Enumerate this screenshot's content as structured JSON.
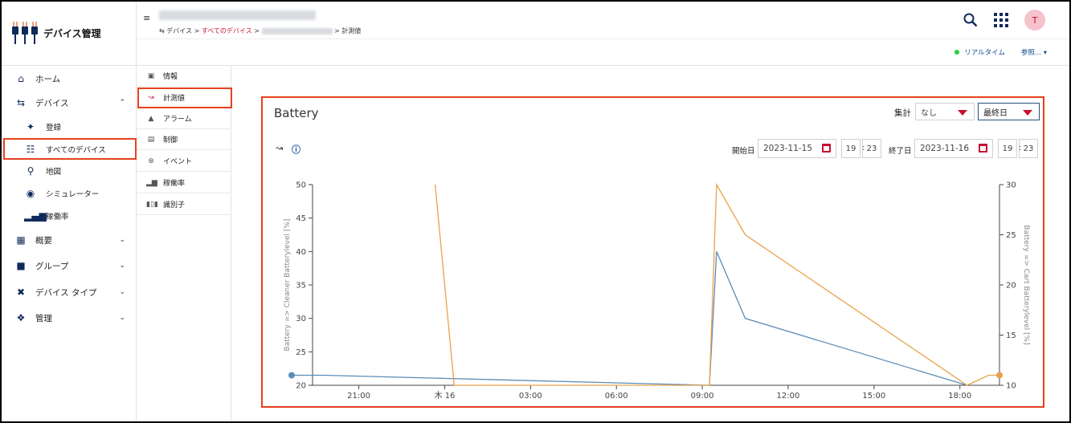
{
  "app": {
    "name": "デバイス管理"
  },
  "sidebar": {
    "items": [
      {
        "label": "ホーム",
        "icon": "home-icon"
      },
      {
        "label": "デバイス",
        "icon": "transfer-icon"
      },
      {
        "label": "登録",
        "icon": "plug-icon"
      },
      {
        "label": "すべてのデバイス",
        "icon": "devices-icon"
      },
      {
        "label": "地図",
        "icon": "map-pin-icon"
      },
      {
        "label": "シミュレーター",
        "icon": "target-icon"
      },
      {
        "label": "稼働率",
        "icon": "bar-chart-icon"
      },
      {
        "label": "概要",
        "icon": "dashboard-icon"
      },
      {
        "label": "グループ",
        "icon": "folder-icon"
      },
      {
        "label": "デバイス タイプ",
        "icon": "plugs-icon"
      },
      {
        "label": "管理",
        "icon": "handshake-icon"
      }
    ]
  },
  "header": {
    "breadcrumb": {
      "root": "デバイス",
      "all_devices": "すべてのデバイス",
      "current": "計測値",
      "separator": ">"
    },
    "avatar": "T",
    "realtime": "リアルタイム",
    "reference": "参照..."
  },
  "submenu": {
    "items": [
      {
        "label": "情報"
      },
      {
        "label": "計測値"
      },
      {
        "label": "アラーム"
      },
      {
        "label": "制御"
      },
      {
        "label": "イベント"
      },
      {
        "label": "稼働率"
      },
      {
        "label": "識別子"
      }
    ]
  },
  "panel": {
    "title": "Battery",
    "aggregation_label": "集計",
    "aggregation_value": "なし",
    "range_value": "最終日",
    "start_label": "開始日",
    "start_date": "2023-11-15",
    "start_hour": "19",
    "start_minute": "23",
    "end_label": "終了日",
    "end_date": "2023-11-16",
    "end_hour": "19",
    "end_minute": "23",
    "time_separator": ":"
  },
  "colors": {
    "accent": "#c8102e",
    "highlight": "#e8401e",
    "series1": "#5b8db8",
    "series2": "#e8a24a"
  },
  "chart_data": {
    "type": "line",
    "x_ticks": [
      "21:00",
      "木 16",
      "03:00",
      "06:00",
      "09:00",
      "12:00",
      "15:00",
      "18:00"
    ],
    "x_range": [
      "2023-11-15 19:23",
      "2023-11-16 19:23"
    ],
    "y_left": {
      "label": "Battery => Cleaner Batterylevel [%]",
      "range": [
        20,
        50
      ],
      "ticks": [
        20,
        25,
        30,
        35,
        40,
        45,
        50
      ]
    },
    "y_right": {
      "label": "Battery => Cart Batterylevel [%]",
      "range": [
        10,
        30
      ],
      "ticks": [
        10,
        15,
        20,
        25,
        30
      ]
    },
    "series": [
      {
        "axis": "left",
        "color": "#5b8db8",
        "points": [
          [
            "2023-11-15 19:23",
            21.5
          ],
          [
            "2023-11-15 19:45",
            21.5
          ],
          [
            "2023-11-16 09:15",
            20
          ],
          [
            "2023-11-16 09:30",
            40
          ],
          [
            "2023-11-16 10:30",
            30
          ],
          [
            "2023-11-16 18:15",
            20
          ]
        ]
      },
      {
        "axis": "right",
        "color": "#e8a24a",
        "points": [
          [
            "2023-11-15 23:40",
            30
          ],
          [
            "2023-11-16 00:20",
            10
          ],
          [
            "2023-11-16 09:15",
            10
          ],
          [
            "2023-11-16 09:30",
            30
          ],
          [
            "2023-11-16 10:30",
            25
          ],
          [
            "2023-11-16 18:15",
            10
          ],
          [
            "2023-11-16 19:00",
            11
          ],
          [
            "2023-11-16 19:23",
            11
          ]
        ]
      }
    ]
  }
}
